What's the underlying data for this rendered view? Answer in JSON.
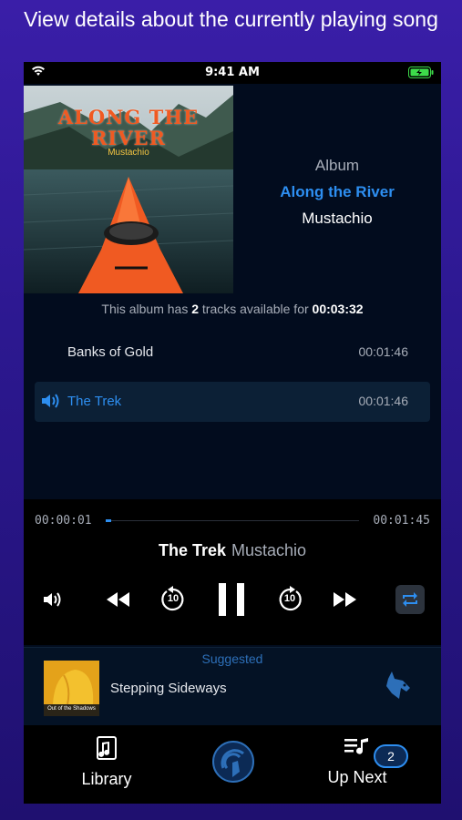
{
  "caption": "View details about the currently playing song",
  "status": {
    "time": "9:41 AM"
  },
  "album": {
    "art_title_line1": "ALONG THE",
    "art_title_line2": "RIVER",
    "art_artist": "Mustachio",
    "label": "Album",
    "name": "Along the River",
    "artist": "Mustachio"
  },
  "summary": {
    "prefix": "This album has",
    "count": "2",
    "middle": "tracks available for",
    "total": "00:03:32"
  },
  "tracks": [
    {
      "title": "Banks of Gold",
      "duration": "00:01:46",
      "playing": false
    },
    {
      "title": "The Trek",
      "duration": "00:01:46",
      "playing": true
    }
  ],
  "player": {
    "elapsed": "00:00:01",
    "remaining": "00:01:45",
    "progress_fraction": 0.01,
    "title": "The Trek",
    "artist": "Mustachio",
    "skip_back_seconds": "10",
    "skip_forward_seconds": "10"
  },
  "suggested": {
    "label": "Suggested",
    "song": "Stepping Sideways",
    "thumb_text": "Out of the Shadows"
  },
  "tabs": {
    "library": "Library",
    "up_next": "Up Next",
    "up_next_count": "2"
  },
  "colors": {
    "accent": "#2d8ef0",
    "background": "#020c1e",
    "kayak": "#f05a22"
  }
}
